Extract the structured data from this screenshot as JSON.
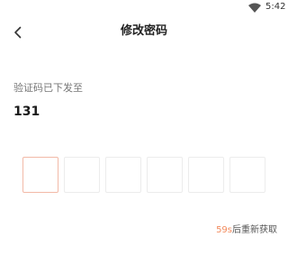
{
  "status_bar": {
    "time": "5:42",
    "icons": [
      "wifi-icon"
    ]
  },
  "header": {
    "back_icon": "chevron-left-icon",
    "title": "修改密码"
  },
  "verification": {
    "hint": "验证码已下发至",
    "phone": "131",
    "code_digits": [
      "",
      "",
      "",
      "",
      "",
      ""
    ],
    "active_index": 0
  },
  "resend": {
    "countdown": "59s",
    "label": "后重新获取"
  },
  "colors": {
    "accent": "#f28a5c",
    "active_box_border": "#f2b9a7",
    "box_border": "#ececec",
    "hint_text": "#777777"
  }
}
